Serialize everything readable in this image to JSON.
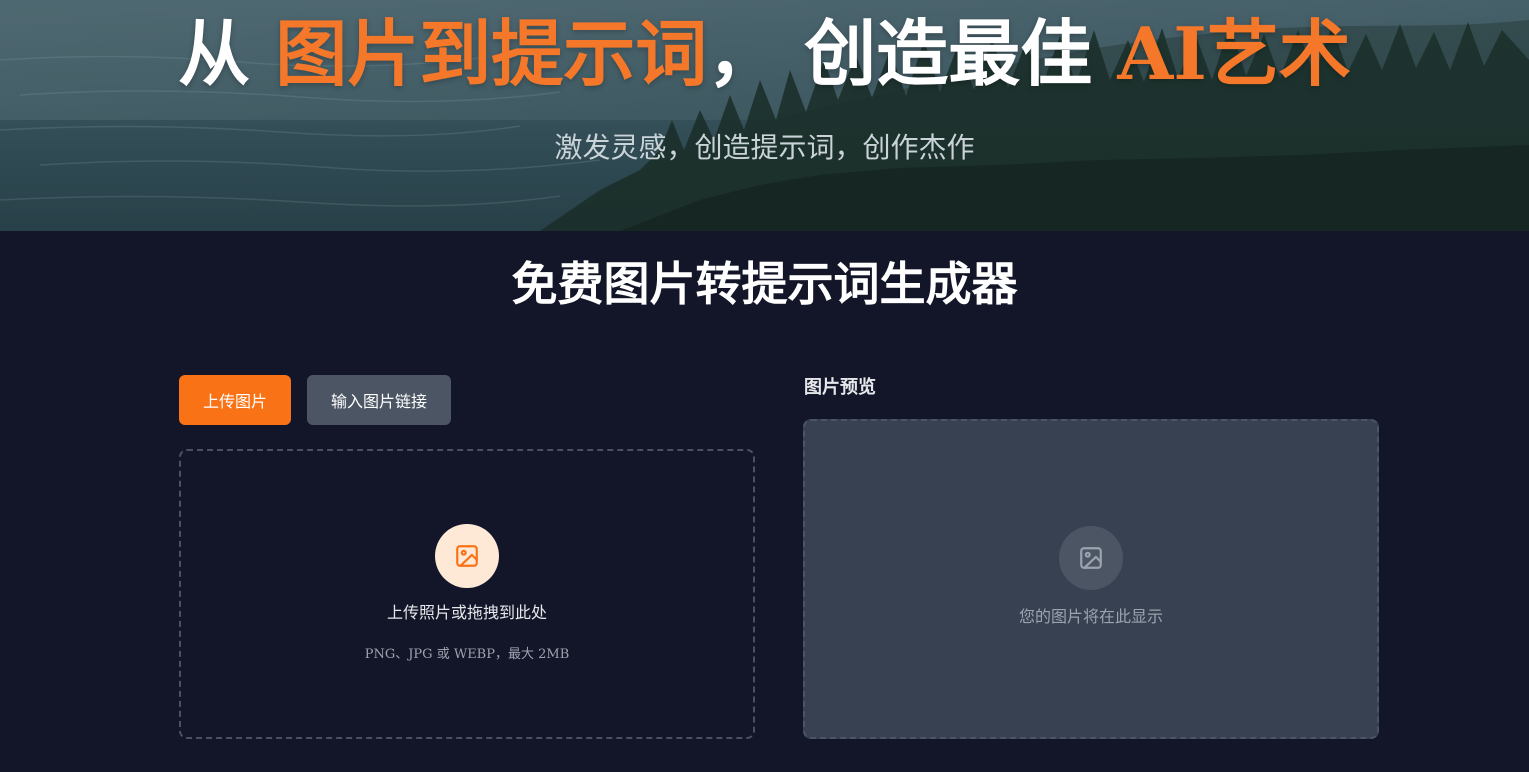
{
  "hero": {
    "title_part1": "从 ",
    "title_accent1": "图片到提示词",
    "title_part2": "， 创造最佳 ",
    "title_accent2": "AI艺术",
    "subtitle": "激发灵感，创造提示词，创作杰作"
  },
  "main": {
    "heading": "免费图片转提示词生成器",
    "tabs": [
      {
        "label": "上传图片",
        "active": true
      },
      {
        "label": "输入图片链接",
        "active": false
      }
    ],
    "dropzone": {
      "icon": "image-icon",
      "label": "上传照片或拖拽到此处",
      "hint": "PNG、JPG 或 WEBP，最大 2MB"
    },
    "preview": {
      "title": "图片预览",
      "icon": "image-icon",
      "placeholder": "您的图片将在此显示"
    }
  },
  "colors": {
    "accent": "#f97316",
    "background": "#131628",
    "secondary_button": "#4b5563",
    "preview_panel": "#374151"
  }
}
